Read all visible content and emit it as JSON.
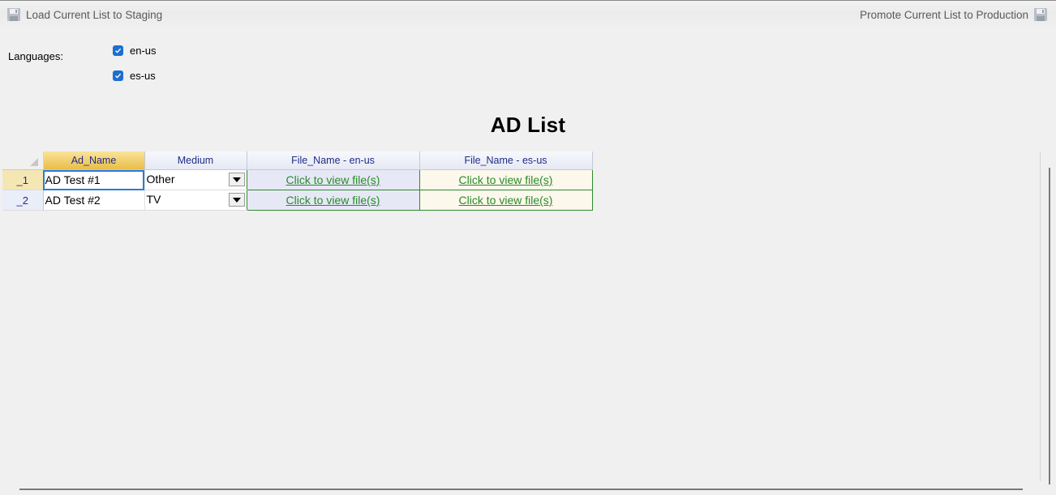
{
  "toolbar": {
    "load_label": "Load Current List to Staging",
    "promote_label": "Promote Current List to Production",
    "load_icon": "floppy-disk-icon",
    "promote_icon": "floppy-disk-icon"
  },
  "languages": {
    "label": "Languages:",
    "items": [
      {
        "code": "en-us",
        "checked": true
      },
      {
        "code": "es-us",
        "checked": true
      }
    ]
  },
  "title": "AD List",
  "grid": {
    "columns": [
      "Ad_Name",
      "Medium",
      "File_Name - en-us",
      "File_Name - es-us"
    ],
    "rows": [
      {
        "num": "_1",
        "ad_name": "AD Test #1",
        "medium": "Other",
        "file_en": "Click to view file(s)",
        "file_es": "Click to view file(s)"
      },
      {
        "num": "_2",
        "ad_name": "AD Test #2",
        "medium": "TV",
        "file_en": "Click to view file(s)",
        "file_es": "Click to view file(s)"
      }
    ]
  },
  "colors": {
    "accent": "#1c6fd1",
    "link": "#2a8a2a",
    "header_text": "#1f2d86",
    "selected_header": "#e9bd48"
  }
}
